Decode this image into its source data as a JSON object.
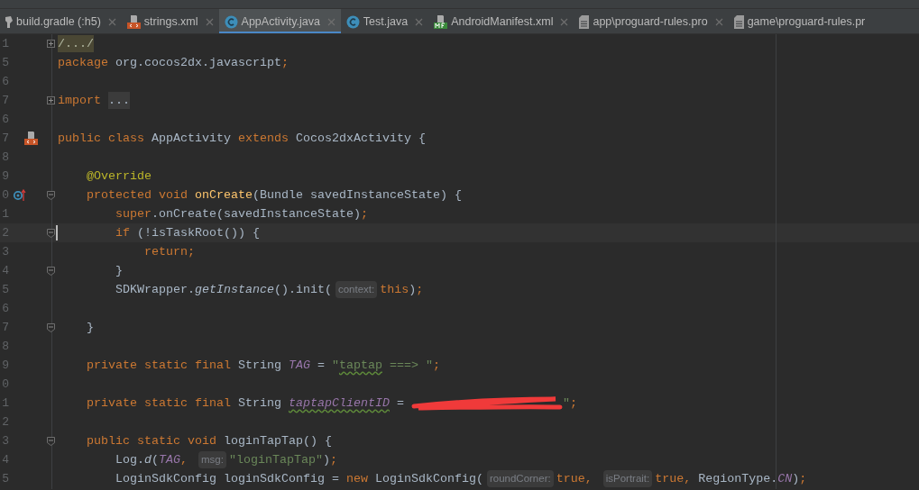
{
  "tabs": [
    {
      "label": "build.gradle (:h5)",
      "kind": "gradle",
      "selected": false,
      "closable": true
    },
    {
      "label": "strings.xml",
      "kind": "xml",
      "selected": false,
      "closable": true
    },
    {
      "label": "AppActivity.java",
      "kind": "class",
      "selected": true,
      "closable": true
    },
    {
      "label": "Test.java",
      "kind": "class",
      "selected": false,
      "closable": true
    },
    {
      "label": "AndroidManifest.xml",
      "kind": "manifest",
      "selected": false,
      "closable": true
    },
    {
      "label": "app\\proguard-rules.pro",
      "kind": "file",
      "selected": false,
      "closable": true
    },
    {
      "label": "game\\proguard-rules.pr",
      "kind": "file",
      "selected": false,
      "closable": false
    }
  ],
  "editor": {
    "lines": [
      {
        "number": "1",
        "fold_marker": {
          "kind": "expand"
        },
        "current": false,
        "tokens": [
          {
            "text": "/.../",
            "kind": "folded"
          }
        ]
      },
      {
        "number": "5",
        "current": false,
        "tokens": [
          {
            "text": "package",
            "kind": "keyword"
          },
          {
            "text": " org.cocos2dx.javascript",
            "kind": "plain"
          },
          {
            "text": ";",
            "kind": "keyword"
          }
        ]
      },
      {
        "number": "6",
        "current": false
      },
      {
        "number": "7",
        "fold_marker": {
          "kind": "expand"
        },
        "current": false,
        "tokens": [
          {
            "text": "import",
            "kind": "keyword"
          },
          {
            "text": "...",
            "kind": "folded"
          }
        ]
      },
      {
        "number": "6",
        "current": false
      },
      {
        "number": "7",
        "gutter_mark": {
          "kind": "xml"
        },
        "current": false,
        "tokens": [
          {
            "text": "public class",
            "kind": "keyword"
          },
          {
            "text": " AppActivity ",
            "kind": "plain"
          },
          {
            "text": "extends",
            "kind": "keyword"
          },
          {
            "text": " Cocos2dxActivity {",
            "kind": "plain"
          }
        ]
      },
      {
        "number": "8",
        "current": false
      },
      {
        "number": "9",
        "current": false,
        "tokens": [
          {
            "text": "    @Override",
            "kind": "annotation"
          }
        ]
      },
      {
        "number": "0",
        "gutter_mark": {
          "kind": "override"
        },
        "fold_marker": {
          "kind": "collapse"
        },
        "current": false,
        "tokens": [
          {
            "text": "    protected void ",
            "kind": "keyword"
          },
          {
            "text": "onCreate",
            "kind": "method"
          },
          {
            "text": "(Bundle savedInstanceState) {",
            "kind": "plain"
          }
        ]
      },
      {
        "number": "1",
        "current": false,
        "tokens": [
          {
            "text": "        super",
            "kind": "keyword"
          },
          {
            "text": ".onCreate(savedInstanceState)",
            "kind": "plain"
          },
          {
            "text": ";",
            "kind": "keyword"
          }
        ]
      },
      {
        "number": "2",
        "fold_marker": {
          "kind": "collapse"
        },
        "current": true,
        "tokens": [
          {
            "text": "        if",
            "kind": "keyword"
          },
          {
            "text": " (!isTaskRoot()) {",
            "kind": "plain"
          }
        ]
      },
      {
        "number": "3",
        "current": false,
        "tokens": [
          {
            "text": "            return",
            "kind": "keyword"
          },
          {
            "text": ";",
            "kind": "keyword"
          }
        ]
      },
      {
        "number": "4",
        "fold_marker": {
          "kind": "collapse"
        },
        "current": false,
        "tokens": [
          {
            "text": "        }",
            "kind": "plain"
          }
        ]
      },
      {
        "number": "5",
        "current": false,
        "tokens": [
          {
            "text": "        SDKWrapper.",
            "kind": "plain"
          },
          {
            "text": "getInstance",
            "kind": "italic"
          },
          {
            "text": "().init(",
            "kind": "plain"
          },
          {
            "text": "context:",
            "kind": "hint"
          },
          {
            "text": "this",
            "kind": "keyword"
          },
          {
            "text": ")",
            "kind": "plain"
          },
          {
            "text": ";",
            "kind": "keyword"
          }
        ]
      },
      {
        "number": "6",
        "current": false
      },
      {
        "number": "7",
        "fold_marker": {
          "kind": "collapse"
        },
        "current": false,
        "tokens": [
          {
            "text": "    }",
            "kind": "plain"
          }
        ]
      },
      {
        "number": "8",
        "current": false
      },
      {
        "number": "9",
        "current": false,
        "tokens": [
          {
            "text": "    private static final",
            "kind": "keyword"
          },
          {
            "text": " String ",
            "kind": "plain"
          },
          {
            "text": "TAG",
            "kind": "static"
          },
          {
            "text": " = ",
            "kind": "plain"
          },
          {
            "text": "\"",
            "kind": "string"
          },
          {
            "text": "taptap",
            "kind": "string-typo"
          },
          {
            "text": " ===> \"",
            "kind": "string"
          },
          {
            "text": ";",
            "kind": "keyword"
          }
        ]
      },
      {
        "number": "0",
        "current": false
      },
      {
        "number": "1",
        "current": false,
        "tokens": [
          {
            "text": "    private static final",
            "kind": "keyword"
          },
          {
            "text": " String ",
            "kind": "plain"
          },
          {
            "text": "taptapClientID",
            "kind": "static-typo"
          },
          {
            "text": " = ",
            "kind": "plain"
          },
          {
            "kind": "redaction"
          },
          {
            "text": "\"",
            "kind": "string"
          },
          {
            "text": ";",
            "kind": "keyword"
          }
        ]
      },
      {
        "number": "2",
        "current": false
      },
      {
        "number": "3",
        "fold_marker": {
          "kind": "collapse"
        },
        "current": false,
        "tokens": [
          {
            "text": "    public static void",
            "kind": "keyword"
          },
          {
            "text": " loginTapTap() {",
            "kind": "plain"
          }
        ]
      },
      {
        "number": "4",
        "current": false,
        "tokens": [
          {
            "text": "        Log.",
            "kind": "plain"
          },
          {
            "text": "d",
            "kind": "italic"
          },
          {
            "text": "(",
            "kind": "plain"
          },
          {
            "text": "TAG",
            "kind": "static"
          },
          {
            "text": ",",
            "kind": "keyword"
          },
          {
            "text": "msg:",
            "kind": "hint"
          },
          {
            "text": "\"loginTapTap\"",
            "kind": "string"
          },
          {
            "text": ")",
            "kind": "plain"
          },
          {
            "text": ";",
            "kind": "keyword"
          }
        ]
      },
      {
        "number": "5",
        "current": false,
        "tokens": [
          {
            "text": "        LoginSdkConfig loginSdkConfig = ",
            "kind": "plain"
          },
          {
            "text": "new",
            "kind": "keyword"
          },
          {
            "text": " LoginSdkConfig(",
            "kind": "plain"
          },
          {
            "text": "roundCorner:",
            "kind": "hint"
          },
          {
            "text": "true",
            "kind": "keyword"
          },
          {
            "text": ",",
            "kind": "keyword"
          },
          {
            "text": "isPortrait:",
            "kind": "hint"
          },
          {
            "text": "true",
            "kind": "keyword"
          },
          {
            "text": ",",
            "kind": "keyword"
          },
          {
            "text": " RegionType.",
            "kind": "plain"
          },
          {
            "text": "CN",
            "kind": "static"
          },
          {
            "text": ")",
            "kind": "plain"
          },
          {
            "text": ";",
            "kind": "keyword"
          }
        ]
      }
    ]
  }
}
